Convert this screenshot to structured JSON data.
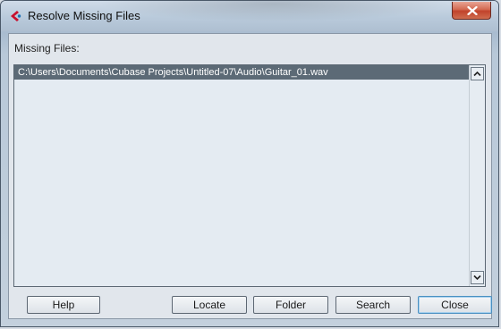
{
  "window": {
    "title": "Resolve Missing Files",
    "close_glyph": "x"
  },
  "missing_files": {
    "label": "Missing Files:",
    "items": [
      "C:\\Users\\Documents\\Cubase Projects\\Untitled-07\\Audio\\Guitar_01.wav"
    ],
    "selected_index": 0
  },
  "buttons": {
    "help": "Help",
    "locate": "Locate",
    "folder": "Folder",
    "search": "Search",
    "close": "Close"
  },
  "colors": {
    "accent": "#c8102e",
    "selection": "#5c6a76",
    "close_button": "#c1432b"
  },
  "icons": {
    "app": "cubase-icon",
    "close": "close-icon",
    "scroll_up": "chevron-up-icon",
    "scroll_down": "chevron-down-icon"
  }
}
